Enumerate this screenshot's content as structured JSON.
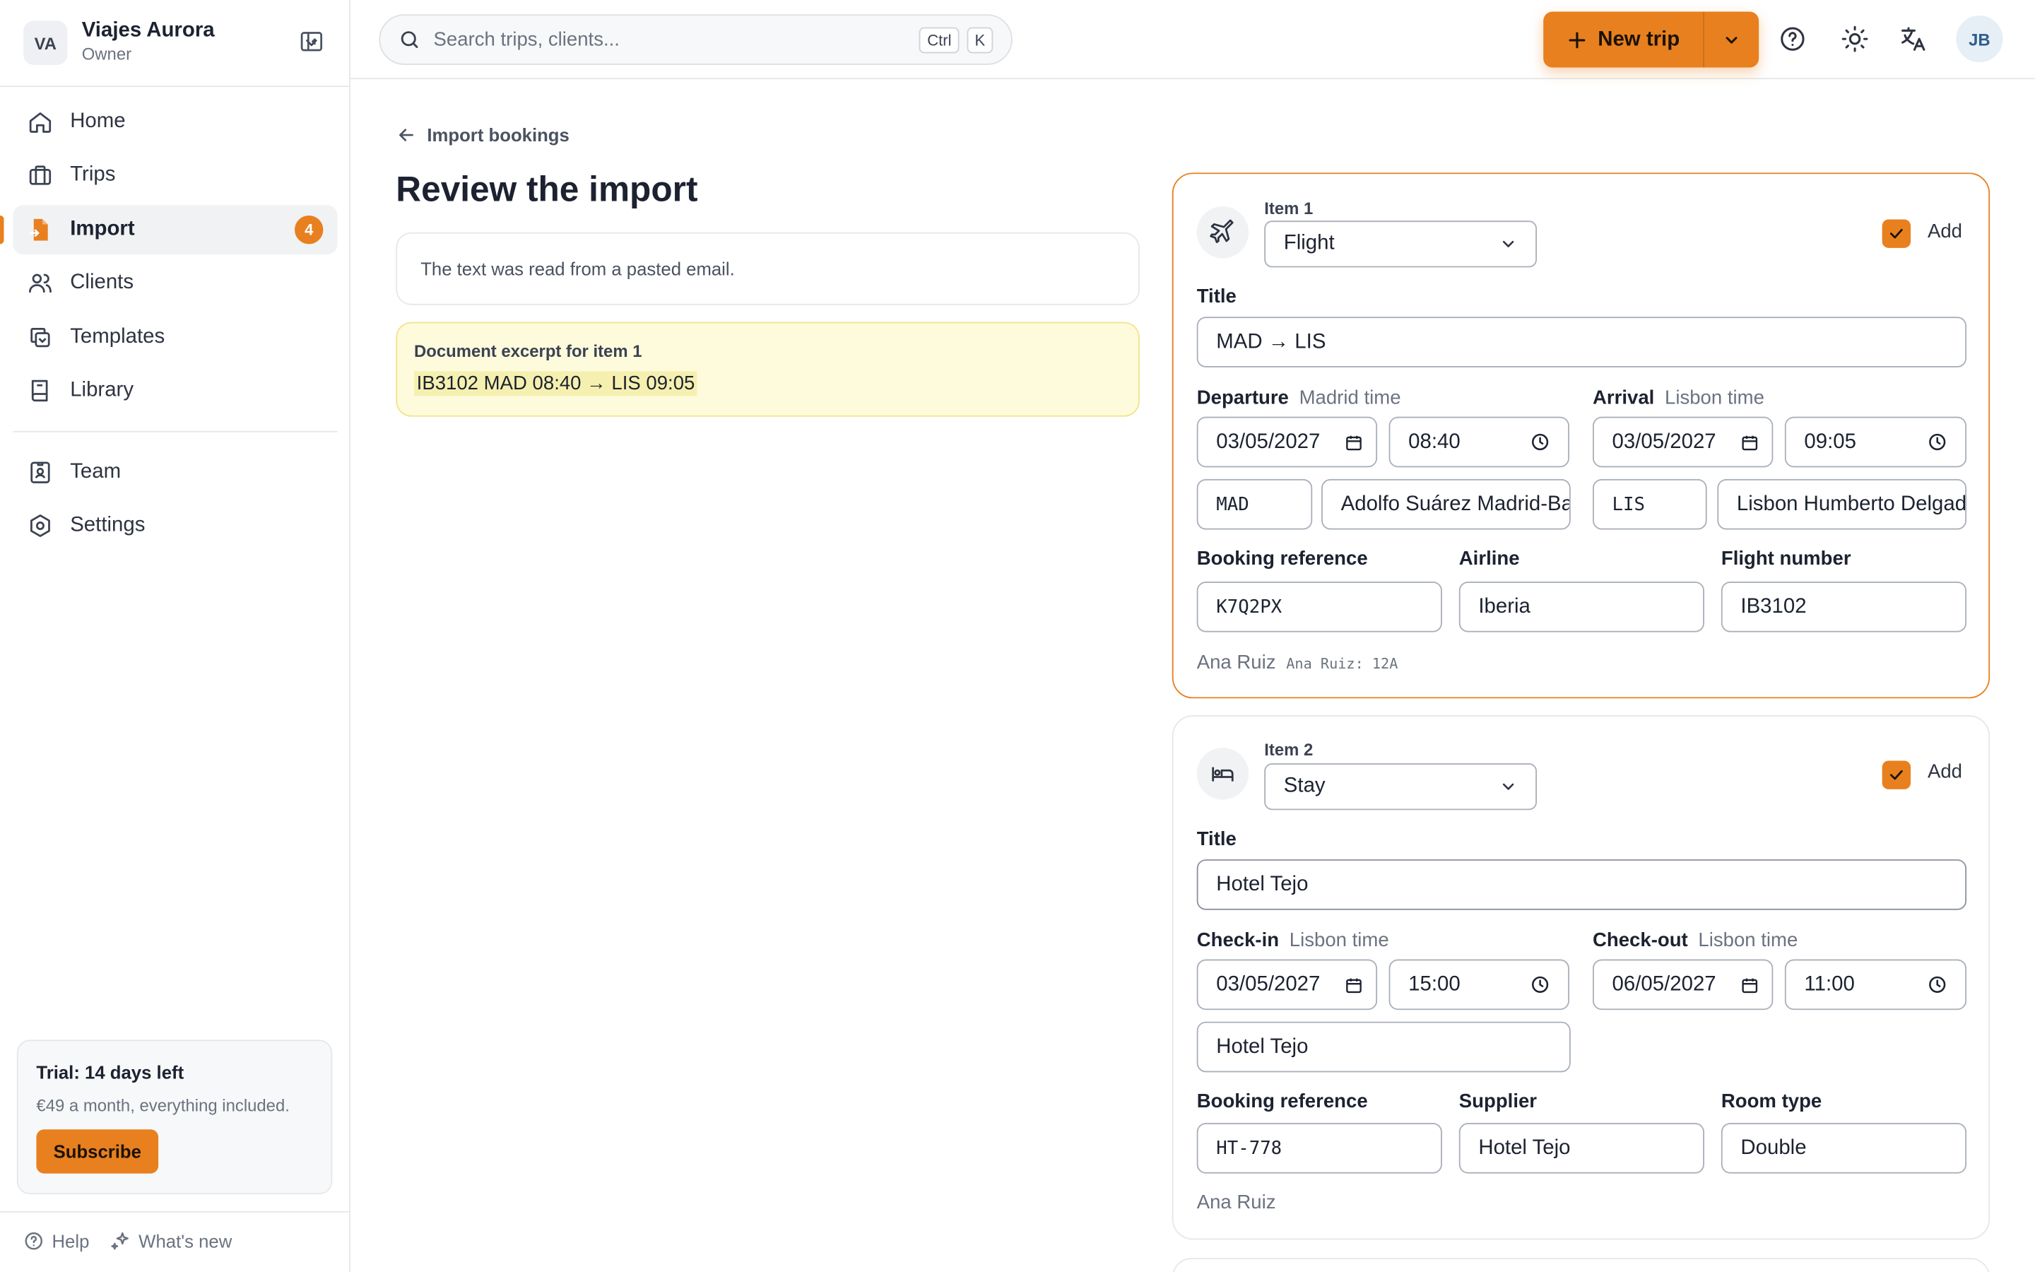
{
  "org": {
    "initials": "VA",
    "name": "Viajes Aurora",
    "role": "Owner"
  },
  "nav": {
    "items": [
      {
        "label": "Home",
        "icon": "home-icon"
      },
      {
        "label": "Trips",
        "icon": "briefcase-icon"
      },
      {
        "label": "Import",
        "icon": "file-import-icon",
        "badge": "4",
        "active": true
      },
      {
        "label": "Clients",
        "icon": "users-icon"
      },
      {
        "label": "Templates",
        "icon": "copy-icon"
      },
      {
        "label": "Library",
        "icon": "book-icon"
      }
    ],
    "secondary": [
      {
        "label": "Team",
        "icon": "id-badge-icon"
      },
      {
        "label": "Settings",
        "icon": "gear-icon"
      }
    ]
  },
  "trial": {
    "title": "Trial: 14 days left",
    "subtitle": "€49 a month, everything included.",
    "button": "Subscribe"
  },
  "footer": {
    "help": "Help",
    "whats_new": "What's new"
  },
  "search": {
    "placeholder": "Search trips, clients...",
    "kbd1": "Ctrl",
    "kbd2": "K"
  },
  "topbar": {
    "new_trip": "New trip",
    "user_initials": "JB"
  },
  "page": {
    "back_label": "Import bookings",
    "title": "Review the import",
    "info": "The text was read from a pasted email.",
    "excerpt_title": "Document excerpt for item 1",
    "excerpt_text": "IB3102 MAD 08:40 → LIS 09:05"
  },
  "item1": {
    "label": "Item 1",
    "type": "Flight",
    "add_label": "Add",
    "title_label": "Title",
    "title": "MAD → LIS",
    "departure_label": "Departure",
    "departure_tz": "Madrid time",
    "arrival_label": "Arrival",
    "arrival_tz": "Lisbon time",
    "dep_date": "03/05/2027",
    "dep_time": "08:40",
    "arr_date": "03/05/2027",
    "arr_time": "09:05",
    "dep_code": "MAD",
    "dep_airport": "Adolfo Suárez Madrid-Barajas",
    "arr_code": "LIS",
    "arr_airport": "Lisbon Humberto Delgado",
    "booking_ref_label": "Booking reference",
    "booking_ref": "K7Q2PX",
    "airline_label": "Airline",
    "airline": "Iberia",
    "flight_no_label": "Flight number",
    "flight_no": "IB3102",
    "traveler": "Ana Ruiz",
    "seat": "Ana Ruiz: 12A"
  },
  "item2": {
    "label": "Item 2",
    "type": "Stay",
    "add_label": "Add",
    "title_label": "Title",
    "title": "Hotel Tejo",
    "checkin_label": "Check-in",
    "checkin_tz": "Lisbon time",
    "checkout_label": "Check-out",
    "checkout_tz": "Lisbon time",
    "in_date": "03/05/2027",
    "in_time": "15:00",
    "out_date": "06/05/2027",
    "out_time": "11:00",
    "place": "Hotel Tejo",
    "booking_ref_label": "Booking reference",
    "booking_ref": "HT-778",
    "supplier_label": "Supplier",
    "supplier": "Hotel Tejo",
    "room_label": "Room type",
    "room": "Double",
    "traveler": "Ana Ruiz"
  },
  "colors": {
    "accent": "#e8801f",
    "excerpt_bg": "#fdfbdc",
    "text": "#1c2230"
  }
}
